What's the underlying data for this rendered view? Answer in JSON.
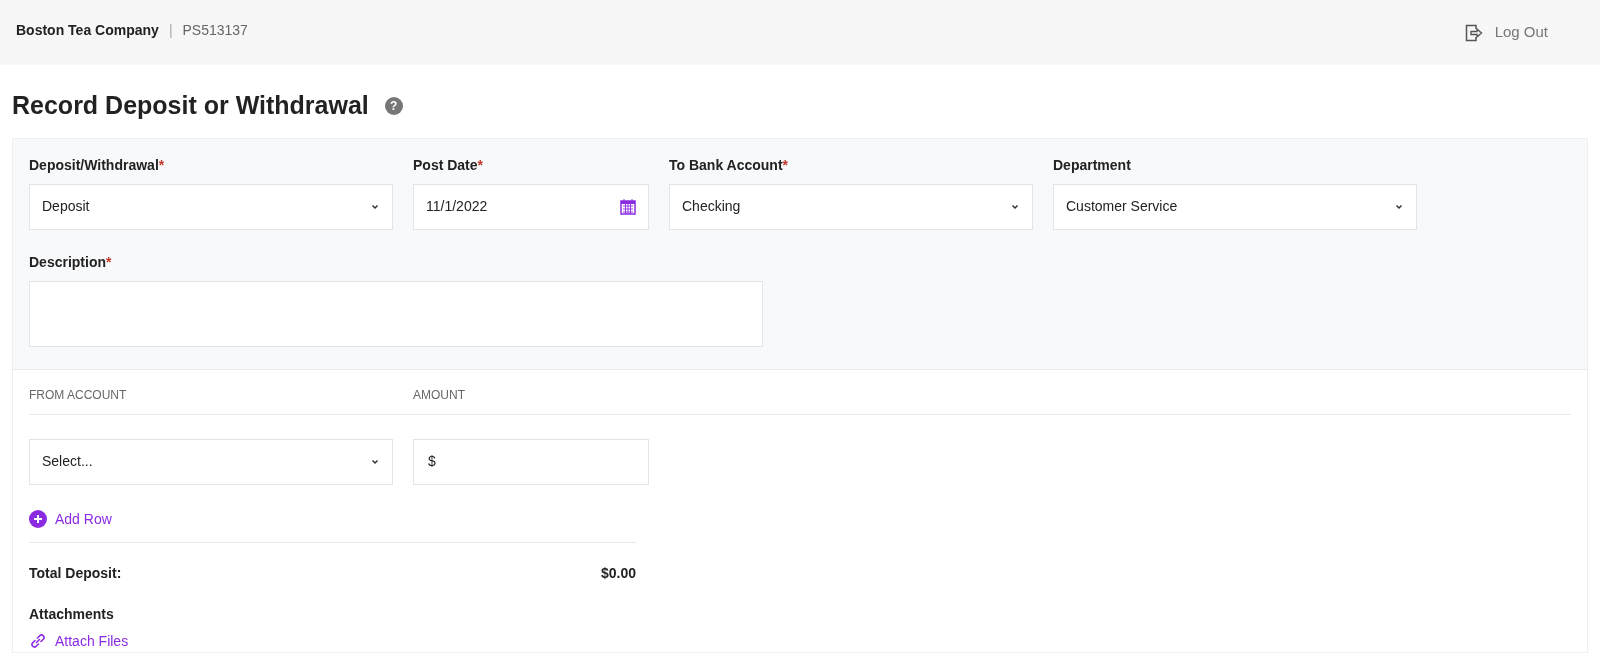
{
  "header": {
    "company": "Boston Tea Company",
    "separator": "|",
    "code": "PS513137",
    "logout": "Log Out"
  },
  "title": "Record Deposit or Withdrawal",
  "help": "?",
  "required_mark": "*",
  "fields": [
    {
      "label": "Deposit/Withdrawal",
      "required": true,
      "kind": "select",
      "value": "Deposit"
    },
    {
      "label": "Post Date",
      "required": true,
      "kind": "date",
      "value": "11/1/2022"
    },
    {
      "label": "To Bank Account",
      "required": true,
      "kind": "select",
      "value": "Checking"
    },
    {
      "label": "Department",
      "required": false,
      "kind": "select",
      "value": "Customer Service"
    }
  ],
  "description": {
    "label": "Description",
    "required": true
  },
  "lines": {
    "columns": [
      "FROM ACCOUNT",
      "AMOUNT"
    ],
    "rows": [
      {
        "account": "Select...",
        "amount": "$"
      }
    ],
    "add_row": "Add Row"
  },
  "total": {
    "label": "Total Deposit:",
    "value": "$0.00"
  },
  "attachments": {
    "label": "Attachments",
    "link": "Attach Files"
  }
}
